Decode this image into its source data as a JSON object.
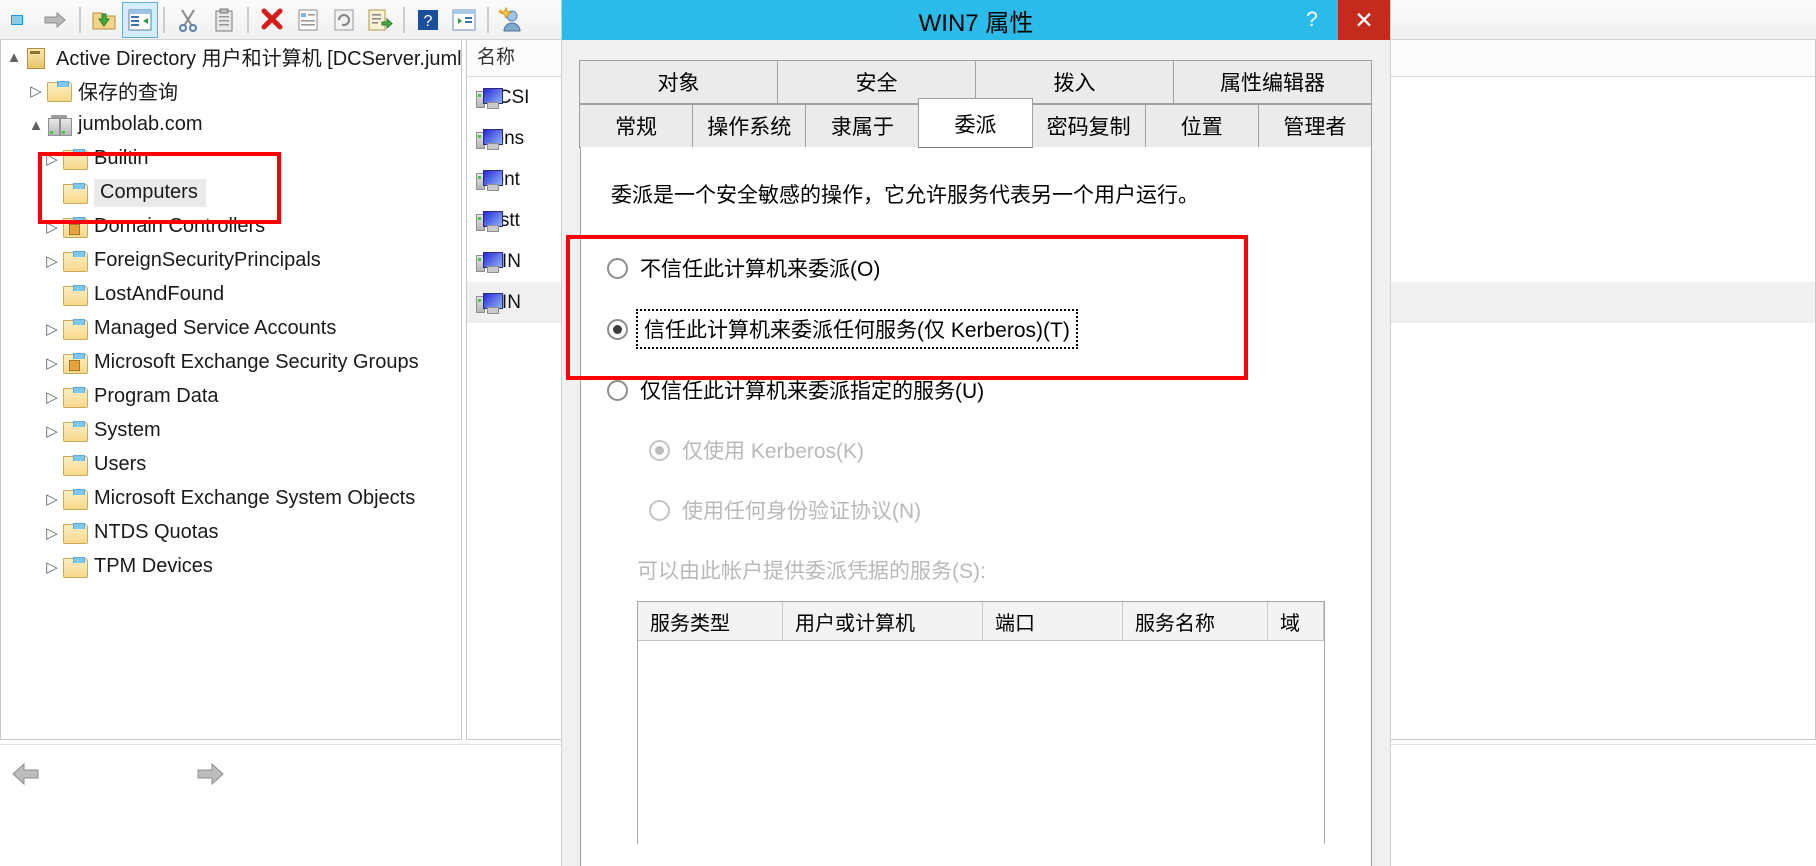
{
  "toolbar": {
    "buttons": [
      {
        "name": "back-icon",
        "glyph": "◀"
      },
      {
        "name": "forward-icon",
        "glyph": "➡"
      },
      {
        "name": "up-folder-icon",
        "glyph": "📂"
      },
      {
        "name": "show-hide-tree-icon",
        "glyph": "▤"
      },
      {
        "name": "cut-icon",
        "glyph": "✂"
      },
      {
        "name": "paste-icon",
        "glyph": "📋"
      },
      {
        "name": "delete-icon",
        "glyph": "✖"
      },
      {
        "name": "properties-icon",
        "glyph": "▤"
      },
      {
        "name": "refresh-icon",
        "glyph": "⟳"
      },
      {
        "name": "export-list-icon",
        "glyph": "⇨"
      },
      {
        "name": "help-icon",
        "glyph": "?"
      },
      {
        "name": "new-window-icon",
        "glyph": "▥"
      },
      {
        "name": "new-user-icon",
        "glyph": "☺"
      }
    ]
  },
  "tree": {
    "root": {
      "label": "Active Directory 用户和计算机 [DCServer.juml",
      "icon": "ad-root-icon"
    },
    "items": [
      {
        "label": "保存的查询",
        "icon": "folder-icon",
        "depth": 1,
        "expander": "▷",
        "selected": false,
        "special": false
      },
      {
        "label": "jumbolab.com",
        "icon": "domain-icon",
        "depth": 1,
        "expander": "▲",
        "selected": false,
        "special": false
      },
      {
        "label": "Builtin",
        "icon": "folder-icon",
        "depth": 2,
        "expander": "▷",
        "selected": false,
        "special": false
      },
      {
        "label": "Computers",
        "icon": "folder-icon",
        "depth": 2,
        "expander": "",
        "selected": true,
        "special": false
      },
      {
        "label": "Domain Controllers",
        "icon": "folder-special-icon",
        "depth": 2,
        "expander": "▷",
        "selected": false,
        "special": true
      },
      {
        "label": "ForeignSecurityPrincipals",
        "icon": "folder-icon",
        "depth": 2,
        "expander": "▷",
        "selected": false,
        "special": false
      },
      {
        "label": "LostAndFound",
        "icon": "folder-icon",
        "depth": 2,
        "expander": "",
        "selected": false,
        "special": false
      },
      {
        "label": "Managed Service Accounts",
        "icon": "folder-icon",
        "depth": 2,
        "expander": "▷",
        "selected": false,
        "special": false
      },
      {
        "label": "Microsoft Exchange Security Groups",
        "icon": "folder-special-icon",
        "depth": 2,
        "expander": "▷",
        "selected": false,
        "special": true
      },
      {
        "label": "Program Data",
        "icon": "folder-icon",
        "depth": 2,
        "expander": "▷",
        "selected": false,
        "special": false
      },
      {
        "label": "System",
        "icon": "folder-icon",
        "depth": 2,
        "expander": "▷",
        "selected": false,
        "special": false
      },
      {
        "label": "Users",
        "icon": "folder-icon",
        "depth": 2,
        "expander": "",
        "selected": false,
        "special": false
      },
      {
        "label": "Microsoft Exchange System Objects",
        "icon": "folder-icon",
        "depth": 2,
        "expander": "▷",
        "selected": false,
        "special": false
      },
      {
        "label": "NTDS Quotas",
        "icon": "folder-icon",
        "depth": 2,
        "expander": "▷",
        "selected": false,
        "special": false
      },
      {
        "label": "TPM Devices",
        "icon": "folder-icon",
        "depth": 2,
        "expander": "▷",
        "selected": false,
        "special": false
      }
    ]
  },
  "list": {
    "columns": [
      "名称"
    ],
    "rows": [
      {
        "label": "DCSI",
        "icon": "computer-icon",
        "selected": false
      },
      {
        "label": "spns",
        "icon": "computer-icon",
        "selected": false
      },
      {
        "label": "spnt",
        "icon": "computer-icon",
        "selected": false
      },
      {
        "label": "testt",
        "icon": "computer-icon",
        "selected": false
      },
      {
        "label": "WIN",
        "icon": "computer-icon",
        "selected": false
      },
      {
        "label": "WIN",
        "icon": "computer-icon",
        "selected": true
      }
    ]
  },
  "dialog": {
    "title": "WIN7 属性",
    "help_label": "?",
    "close_label": "✕",
    "tabs_row1": [
      {
        "label": "对象",
        "active": false
      },
      {
        "label": "安全",
        "active": false
      },
      {
        "label": "拨入",
        "active": false
      },
      {
        "label": "属性编辑器",
        "active": false
      }
    ],
    "tabs_row2": [
      {
        "label": "常规",
        "active": false
      },
      {
        "label": "操作系统",
        "active": false
      },
      {
        "label": "隶属于",
        "active": false
      },
      {
        "label": "委派",
        "active": true
      },
      {
        "label": "密码复制",
        "active": false
      },
      {
        "label": "位置",
        "active": false
      },
      {
        "label": "管理者",
        "active": false
      }
    ],
    "intro": "委派是一个安全敏感的操作，它允许服务代表另一个用户运行。",
    "options": [
      {
        "label": "不信任此计算机来委派(O)",
        "checked": false,
        "disabled": false,
        "focused": false
      },
      {
        "label": "信任此计算机来委派任何服务(仅 Kerberos)(T)",
        "checked": true,
        "disabled": false,
        "focused": true
      },
      {
        "label": "仅信任此计算机来委派指定的服务(U)",
        "checked": false,
        "disabled": false,
        "focused": false
      }
    ],
    "sub_options": [
      {
        "label": "仅使用 Kerberos(K)",
        "checked": true,
        "disabled": true
      },
      {
        "label": "使用任何身份验证协议(N)",
        "checked": false,
        "disabled": true
      }
    ],
    "services_label": "可以由此帐户提供委派凭据的服务(S):",
    "services_columns": [
      "服务类型",
      "用户或计算机",
      "端口",
      "服务名称",
      "域"
    ],
    "services_rows": []
  },
  "colors": {
    "title_bar": "#2bbbe8",
    "close_button": "#c42b1c",
    "annotation": "#ff0000",
    "selection": "#eaeaea"
  },
  "bottom_nav": {
    "back": "⬅",
    "forward": "➡"
  }
}
